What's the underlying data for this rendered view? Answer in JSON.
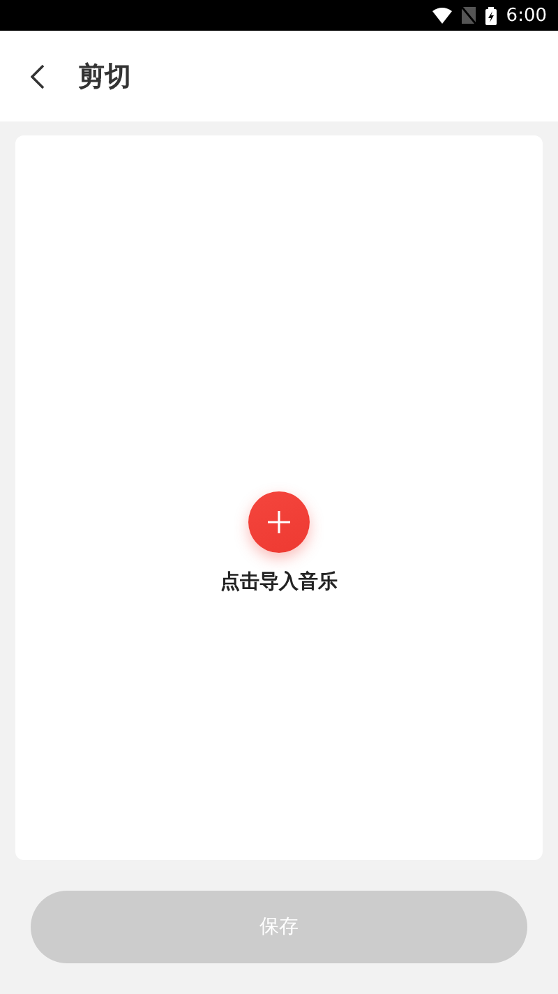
{
  "status_bar": {
    "time": "6:00"
  },
  "header": {
    "title": "剪切"
  },
  "import_area": {
    "label": "点击导入音乐"
  },
  "save_button": {
    "label": "保存",
    "disabled": true
  }
}
